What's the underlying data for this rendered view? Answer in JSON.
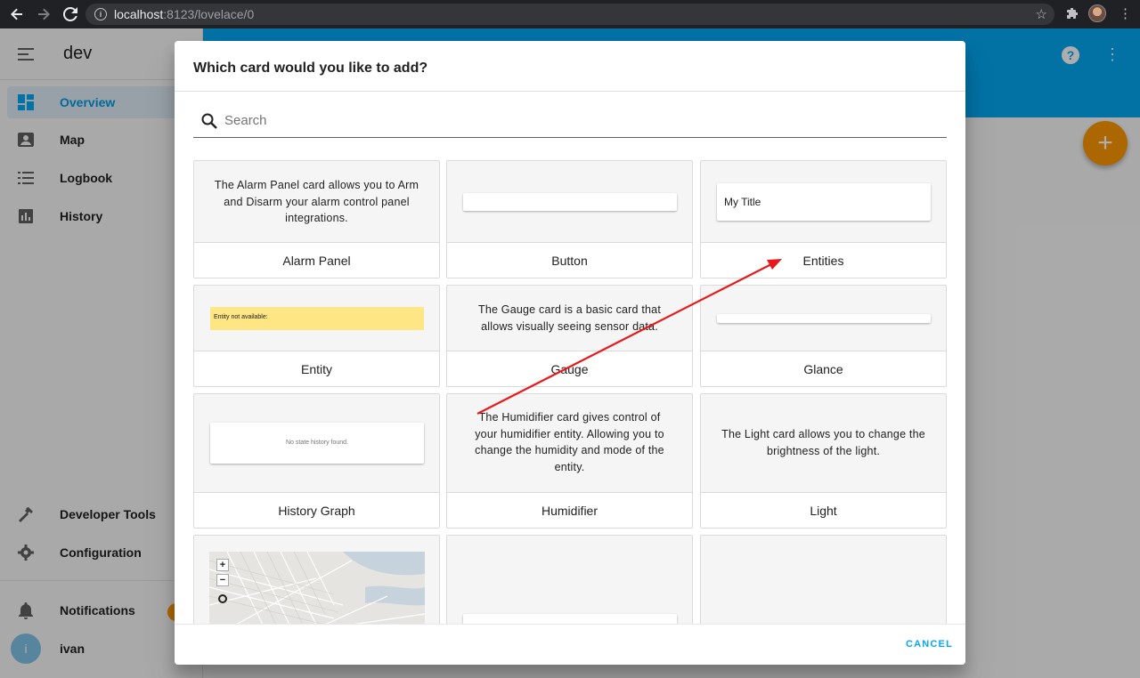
{
  "browser": {
    "url_host": "localhost",
    "url_rest": ":8123/lovelace/0"
  },
  "sidebar": {
    "title": "dev",
    "items": [
      {
        "label": "Overview",
        "icon": "dashboard-icon",
        "active": true
      },
      {
        "label": "Map",
        "icon": "map-icon"
      },
      {
        "label": "Logbook",
        "icon": "logbook-icon"
      },
      {
        "label": "History",
        "icon": "history-icon"
      }
    ],
    "bottom_items": [
      {
        "label": "Developer Tools",
        "icon": "hammer-icon"
      },
      {
        "label": "Configuration",
        "icon": "gear-icon"
      }
    ],
    "notifications_label": "Notifications",
    "user": {
      "initial": "i",
      "name": "ivan"
    }
  },
  "colors": {
    "primary": "#03a9f4",
    "accent": "#ff9800",
    "warning_box": "#ffe684",
    "annotation_arrow": "#e8191b"
  },
  "dialog": {
    "title": "Which card would you like to add?",
    "search_placeholder": "Search",
    "cancel_label": "CANCEL",
    "cards": [
      {
        "name": "Alarm Panel",
        "description": "The Alarm Panel card allows you to Arm and Disarm your alarm control panel integrations."
      },
      {
        "name": "Button"
      },
      {
        "name": "Entities",
        "preview_title": "My Title"
      },
      {
        "name": "Entity",
        "preview_warning": "Entity not available:"
      },
      {
        "name": "Gauge",
        "description": "The Gauge card is a basic card that allows visually seeing sensor data."
      },
      {
        "name": "Glance"
      },
      {
        "name": "History Graph",
        "preview_text": "No state history found."
      },
      {
        "name": "Humidifier",
        "description": "The Humidifier card gives control of your humidifier entity. Allowing you to change the humidity and mode of the entity."
      },
      {
        "name": "Light",
        "description": "The Light card allows you to change the brightness of the light."
      }
    ],
    "map_controls": {
      "zoom_in": "+",
      "zoom_out": "−"
    }
  }
}
